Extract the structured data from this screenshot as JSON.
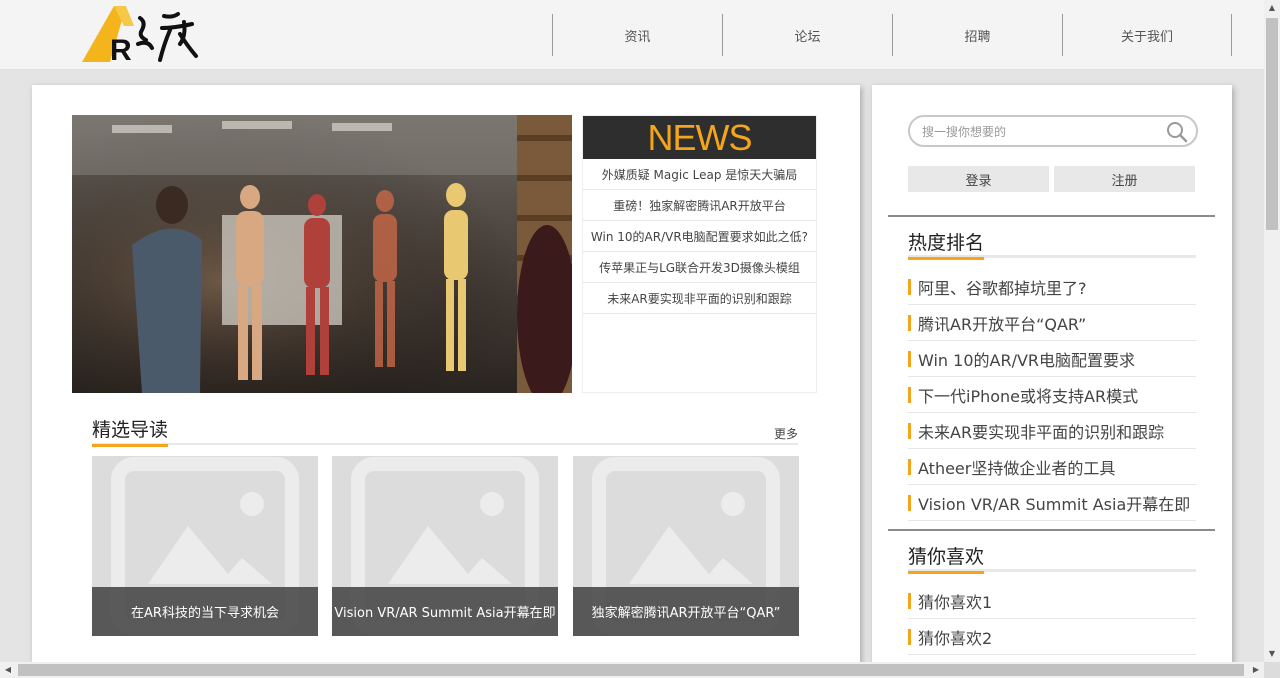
{
  "header": {
    "logo_letter": "R",
    "nav": [
      "资讯",
      "论坛",
      "招聘",
      "关于我们"
    ]
  },
  "news": {
    "title": "NEWS",
    "items": [
      "外媒质疑 Magic Leap 是惊天大骗局",
      "重磅！独家解密腾讯AR开放平台",
      "Win 10的AR/VR电脑配置要求如此之低?",
      "传苹果正与LG联合开发3D摄像头模组",
      "未来AR要实现非平面的识别和跟踪"
    ]
  },
  "featured": {
    "title": "精选导读",
    "more": "更多",
    "cards": [
      "在AR科技的当下寻求机会",
      "Vision VR/AR Summit Asia开幕在即",
      "独家解密腾讯AR开放平台“QAR”"
    ]
  },
  "sidebar": {
    "search_placeholder": "搜一搜你想要的",
    "login": "登录",
    "register": "注册",
    "hot": {
      "title": "热度排名",
      "items": [
        "阿里、谷歌都掉坑里了?",
        "腾讯AR开放平台“QAR”",
        "Win 10的AR/VR电脑配置要求",
        "下一代iPhone或将支持AR模式",
        "未来AR要实现非平面的识别和跟踪",
        "Atheer坚持做企业者的工具",
        "Vision VR/AR Summit Asia开幕在即"
      ]
    },
    "guess": {
      "title": "猜你喜欢",
      "items": [
        "猜你喜欢1",
        "猜你喜欢2"
      ]
    }
  },
  "colors": {
    "accent": "#f4a51c",
    "news_bg": "#2e2e2e"
  }
}
